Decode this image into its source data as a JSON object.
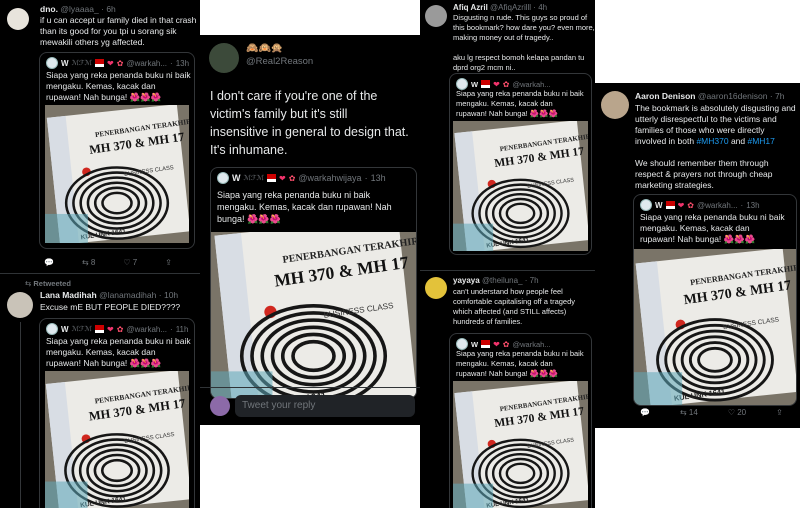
{
  "quoted": {
    "name": "W",
    "handle": "@warkahwijaya",
    "handle_short": "@warkah...",
    "age": "13h",
    "age_alt": "11h",
    "text_line1": "Siapa yang reka penanda buku ni baik",
    "text_line2": "mengaku. Kemas, kacak dan",
    "text_line3": "rupawan! Nah bunga! 🌺🌺🌺",
    "text_full_1": "Siapa yang reka penanda buku ni baik",
    "text_full_2": "mengaku. Kemas, kacak dan rupawan! Nah",
    "text_full_3": "bunga! 🌺🌺🌺"
  },
  "ticket": {
    "title1": "PENERBANGAN TERAKHIR",
    "title2": "MH 370 & MH 17",
    "class": "BUSINESS CLASS",
    "codes": "KUL   UNK   1641",
    "row": "4K    B     A7"
  },
  "panel1": {
    "name": "dno.",
    "handle": "@lyaaaa_",
    "age": "6h",
    "line1": "if u can accept ur family died in that crash",
    "line2": "than its good for you tpi u sorang sik",
    "line3": "mewakili others yg affected.",
    "replies": "",
    "retweets": "8",
    "likes": "7",
    "retweeted_label": "Retweeted",
    "name2": "Lana Madihah",
    "handle2": "@lanamadihah",
    "age2": "10h",
    "line4": "Excuse mE BUT PEOPLE DIED????"
  },
  "panel2": {
    "emojis": "🙈🙉🙊",
    "handle": "@Real2Reason",
    "line1": "I don't care if you're one of the",
    "line2": "victim's family but it's still",
    "line3": "insensitive in general to design that.",
    "line4": "It's inhumane.",
    "reply_placeholder": "Tweet your reply"
  },
  "panel3": {
    "name": "Afiq Azril",
    "handle": "@AfiqAzrilll",
    "age": "4h",
    "line1": "Disgusting n rude. This guys so proud of",
    "line2": "this bookmark? how dare you? even more,",
    "line3": "making money out of tragedy..",
    "line4": "aku lg respect bomoh kelapa pandan tu",
    "line5": "dprd org2  mcm ni..",
    "name2": "yayaya",
    "handle2": "@theiluna_",
    "age2": "7h",
    "line6": "can't understand how people feel",
    "line7": "comfortable capitalising off a tragedy",
    "line8": "which affected (and STILL affects)",
    "line9": "hundreds of families."
  },
  "panel4": {
    "name": "Aaron Denison",
    "handle": "@aaron16denison",
    "age": "7h",
    "line1": "The bookmark is absolutely disgusting and",
    "line2": "utterly disrespectful to the victims and",
    "line3": "families of those who were directly",
    "line4a": "involved in both ",
    "tag1": "#MH370",
    "line4b": " and ",
    "tag2": "#MH17",
    "line5": "We should remember them through",
    "line6": "respect & prayers not through cheap",
    "line7": "marketing strategies.",
    "retweets": "14",
    "likes": "20"
  }
}
